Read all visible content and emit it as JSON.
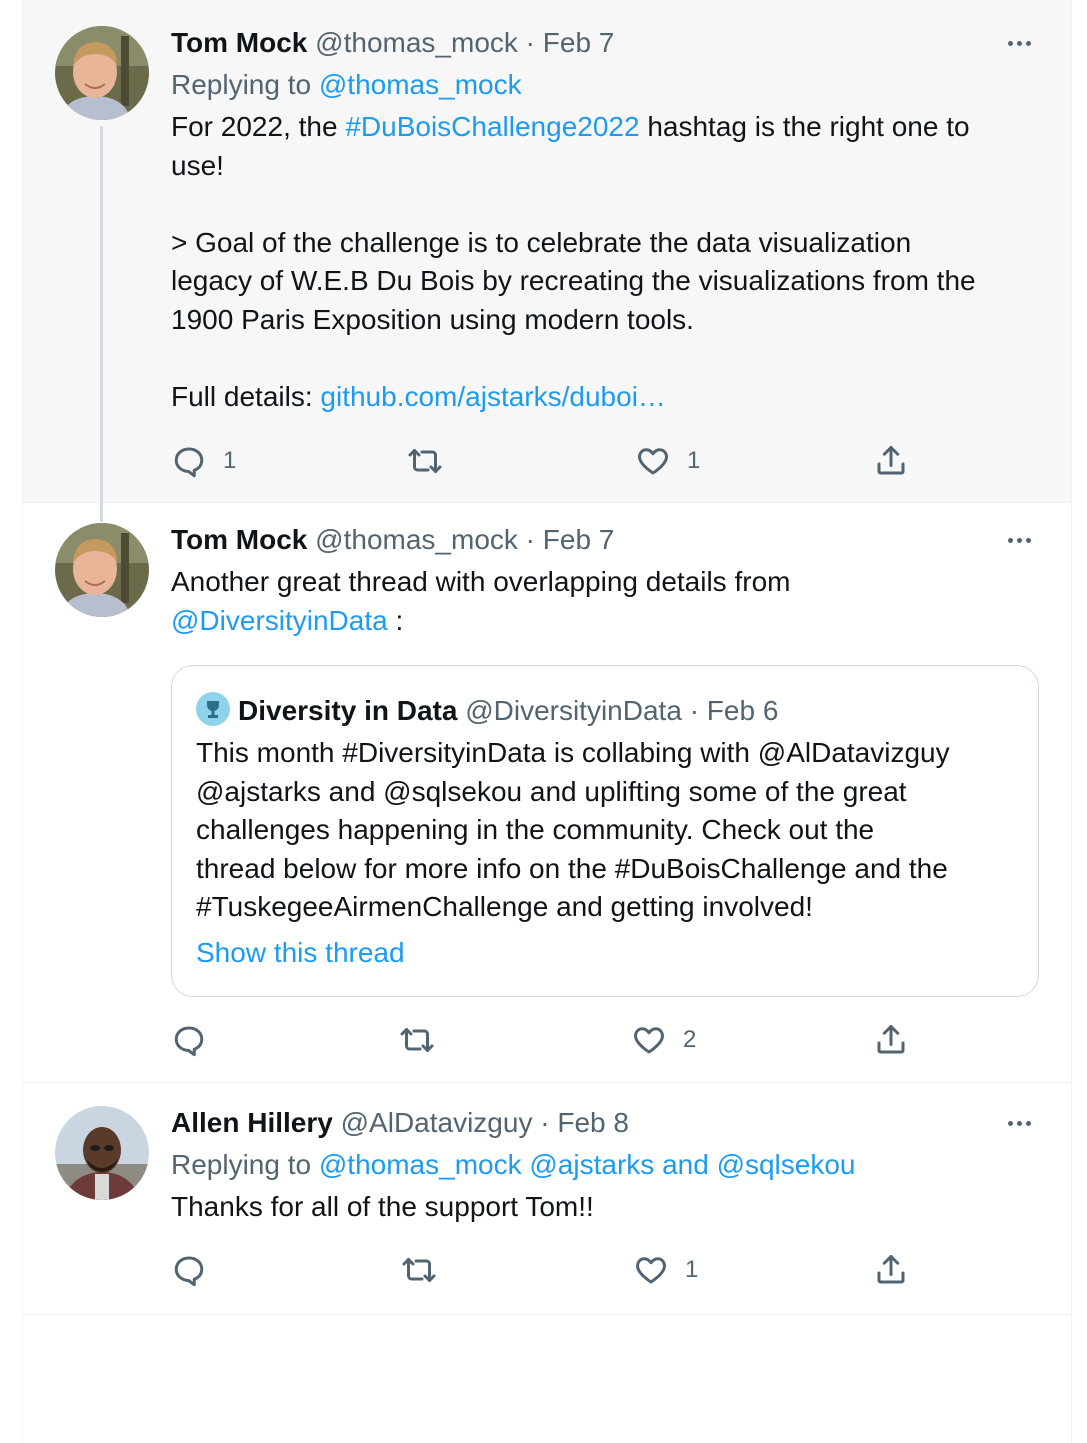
{
  "tweets": [
    {
      "author": "Tom Mock",
      "handle": "@thomas_mock",
      "sep": "·",
      "date": "Feb 7",
      "replying_label": "Replying to",
      "replying_to": "@thomas_mock",
      "text_parts": [
        "For 2022, the ",
        "#DuBoisChallenge2022",
        " hashtag is the right one to\nuse!\n\n> Goal of the challenge is to celebrate the data visualization\nlegacy of W.E.B Du Bois by recreating the visualizations from the\n1900 Paris Exposition using modern tools.\n\nFull details: ",
        "github.com/ajstarks/duboi…"
      ],
      "reply_count": "1",
      "retweet_count": "",
      "like_count": "1"
    },
    {
      "author": "Tom Mock",
      "handle": "@thomas_mock",
      "sep": "·",
      "date": "Feb 7",
      "text_parts": [
        "Another great thread with overlapping details from\n",
        "@DiversityinData",
        " :"
      ],
      "quote": {
        "author": "Diversity in Data",
        "handle": "@DiversityinData",
        "sep": "·",
        "date": "Feb 6",
        "text": "This month #DiversityinData is collabing with @AlDatavizguy\n@ajstarks and @sqlsekou and uplifting some of the great\nchallenges happening in the community. Check out the\nthread below for more info on the #DuBoisChallenge and the\n#TuskegeeAirmenChallenge and getting involved!",
        "show_thread": "Show this thread"
      },
      "reply_count": "",
      "retweet_count": "",
      "like_count": "2"
    },
    {
      "author": "Allen Hillery",
      "handle": "@AlDatavizguy",
      "sep": "·",
      "date": "Feb 8",
      "replying_label": "Replying to",
      "replying_to_1": "@thomas_mock",
      "replying_to_2": "@ajstarks",
      "replying_and": "and",
      "replying_to_3": "@sqlsekou",
      "text": "Thanks for all of the support Tom!!",
      "reply_count": "",
      "retweet_count": "",
      "like_count": "1"
    }
  ],
  "colors": {
    "link": "#1d9bf0",
    "secondary_text": "#536471",
    "focused_bg": "#f7f7f7",
    "thread_line": "#cfd9de"
  },
  "icons": [
    "more-icon",
    "reply-icon",
    "retweet-icon",
    "like-icon",
    "share-icon"
  ]
}
